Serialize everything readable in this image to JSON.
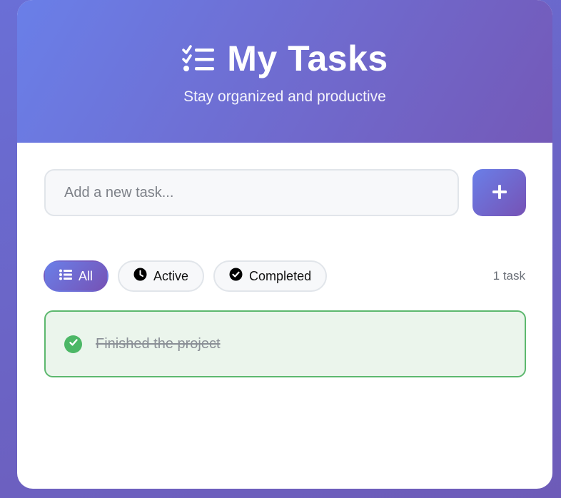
{
  "header": {
    "title": "My Tasks",
    "subtitle": "Stay organized and productive",
    "icon": "checklist-icon"
  },
  "input": {
    "placeholder": "Add a new task...",
    "value": "",
    "add_icon": "plus-icon"
  },
  "filters": [
    {
      "label": "All",
      "icon": "list-icon",
      "active": true
    },
    {
      "label": "Active",
      "icon": "clock-icon",
      "active": false
    },
    {
      "label": "Completed",
      "icon": "check-circle-icon",
      "active": false
    }
  ],
  "task_count": "1 task",
  "tasks": [
    {
      "text": "Finished the project",
      "completed": true
    }
  ],
  "colors": {
    "accent_start": "#6a7fe8",
    "accent_end": "#7652b5",
    "completed_green": "#4cb766"
  }
}
